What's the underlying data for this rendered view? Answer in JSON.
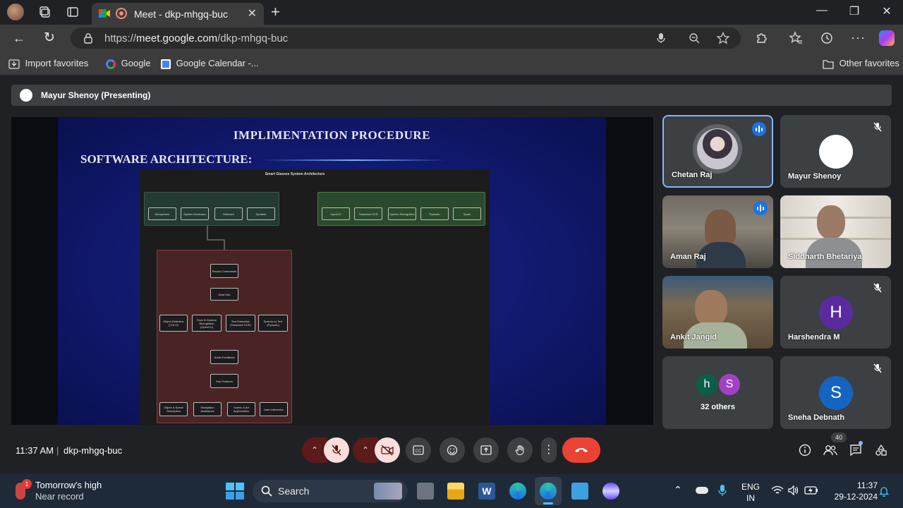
{
  "browser": {
    "tab_title": "Meet - dkp-mhgq-buc",
    "url_prefix": "https://",
    "url_host": "meet.google.com",
    "url_path": "/dkp-mhgq-buc",
    "favorites": [
      "Import favorites",
      "Google",
      "Google Calendar -..."
    ],
    "other_favorites": "Other favorites"
  },
  "meet": {
    "presenter_label": "Mayur Shenoy (Presenting)",
    "slide": {
      "title": "IMPLIMENTATION PROCEDURE",
      "subtitle": "SOFTWARE ARCHITECTURE:",
      "diagram_title": "Smart Glasses System Architecture",
      "hardware_boxes": [
        "Microphone",
        "System Hardware",
        "Webcam",
        "Speaker"
      ],
      "software_boxes": [
        "OpenCV",
        "Tesseract OCR",
        "Speech Recognition",
        "PyAudio",
        "Spark"
      ],
      "flow_boxes": [
        "Record Commands",
        "Data Hub",
        "Audio Feedback",
        "Key Features"
      ],
      "process_boxes": [
        "Object Detection (YOLO)",
        "Face & Gesture Recognition (OpenCV)",
        "Text Extraction (Tesseract OCR)",
        "Speech-to-Text (PyAudio)"
      ],
      "feature_boxes": [
        "Object & Scene Description",
        "Navigation Assistance",
        "Scenic & Art Appreciation",
        "User Interaction"
      ]
    },
    "participants": [
      {
        "name": "Chetan Raj",
        "state": "speaking"
      },
      {
        "name": "Mayur Shenoy",
        "state": "muted"
      },
      {
        "name": "Aman Raj",
        "state": "speaking"
      },
      {
        "name": "Siddharth Bhetariya",
        "state": "video"
      },
      {
        "name": "Ankit Jangid",
        "state": "video"
      },
      {
        "name": "Harshendra M",
        "state": "muted",
        "initial": "H"
      },
      {
        "name": "32 others",
        "state": "group",
        "initials": [
          "h",
          "S"
        ]
      },
      {
        "name": "Sneha Debnath",
        "state": "muted",
        "initial": "S"
      }
    ],
    "time": "11:37 AM",
    "meeting_code": "dkp-mhgq-buc",
    "participant_count": "40"
  },
  "taskbar": {
    "weather_line1": "Tomorrow's high",
    "weather_line2": "Near record",
    "weather_badge": "1",
    "search_placeholder": "Search",
    "lang_line1": "ENG",
    "lang_line2": "IN",
    "time": "11:37",
    "date": "29-12-2024"
  },
  "colors": {
    "end_call": "#ea4335",
    "mic_off": "#f9dedc",
    "accent": "#1a73e8"
  }
}
